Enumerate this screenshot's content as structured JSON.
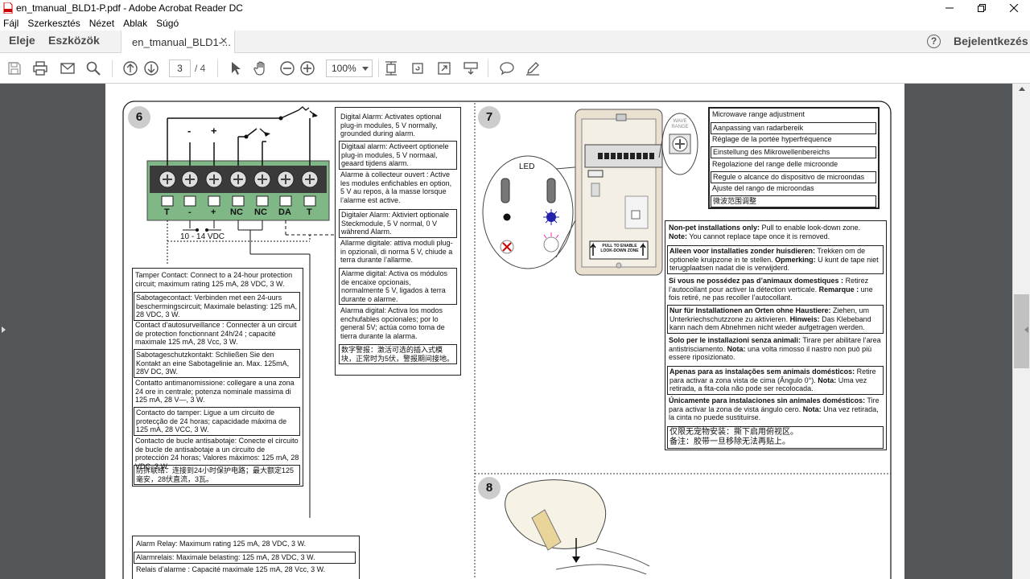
{
  "window": {
    "title": "en_tmanual_BLD1-P.pdf - Adobe Acrobat Reader DC"
  },
  "menu": [
    "Fájl",
    "Szerkesztés",
    "Nézet",
    "Ablak",
    "Súgó"
  ],
  "tabs": {
    "home": "Eleje",
    "tools": "Eszközök",
    "document": "en_tmanual_BLD1-...",
    "help": "?",
    "login": "Bejelentkezés"
  },
  "toolbar": {
    "page_current": "3",
    "page_total": "/ 4",
    "zoom": "100%"
  },
  "doc": {
    "step6": "6",
    "step7": "7",
    "step8": "8",
    "terminals": [
      "T",
      "-",
      "+",
      "NC",
      "NC",
      "DA",
      "T"
    ],
    "top_minus": "-",
    "top_plus": "+",
    "vdc": "10 - 14 VDC",
    "digital_alarm": [
      "Digital Alarm: Activates optional plug-in modules, 5 V normally, grounded during alarm.",
      "Digitaal alarm: Activeert optionele plug-in modules, 5 V normaal, geaard tijdens alarm.",
      "Alarme à collecteur ouvert : Active les modules enfichables en option, 5 V au repos, à la masse lorsque l’alarme est active.",
      "Digitaler Alarm: Aktiviert optionale Steckmodule, 5 V normal, 0 V während Alarm.",
      "Allarme digitale: attiva moduli plug-in opzionali, di norma 5 V, chiude a terra durante l’allarme.",
      "Alarme digital: Activa os módulos de encaixe opcionais, normalmente 5 V, ligados à terra durante o alarme.",
      "Alarma digital: Activa los modos enchufables opcionales; por lo general 5V; actúa como toma de tierra durante la alarma.",
      "数字警报：激活可选的插入式模块，正常时为5伏，警报期间接地。"
    ],
    "tamper": [
      "Tamper Contact: Connect to a 24-hour protection circuit; maximum rating 125 mA, 28 VDC, 3 W.",
      "Sabotagecontact: Verbinden met een 24-uurs beschermingscircuit; Maximale belasting: 125 mA, 28 VDC, 3 W.",
      "Contact d’autosurveillance : Connecter à un circuit de protection fonctionnant 24h/24 ; capacité maximale 125 mA, 28 Vcc, 3 W.",
      "Sabotageschutzkontakt: Schließen Sie den Kontakt an eine Sabotagelinie an.  Max. 125mA, 28V DC, 3W.",
      "Contatto antimanomissione: collegare a una zona 24 ore in centrale; potenza nominale massima di 125 mA, 28 V—, 3 W.",
      "Contacto do tamper: Ligue a um circuito de protecção de 24 horas; capacidade máxima de 125 mA, 28 VCC, 3 W.",
      "Contacto de bucle antisabotaje: Conecte el circuito de bucle de antisabotaje a un circuito de protección 24 horas; Valores máximos: 125 mA, 28 VDC, 3 W.",
      "防拆联络：连接到24小时保护电路；最大额定125毫安，28伏直流，3瓦。"
    ],
    "alarm_relay": [
      "Alarm Relay: Maximum rating 125 mA, 28 VDC, 3 W.",
      "Alarmrelais: Maximale belasting: 125 mA, 28 VDC, 3 W.",
      "Relais d’alarme : Capacité maximale 125 mA, 28 Vcc, 3 W."
    ],
    "led_label": "LED",
    "wave_range": "WAVE RANGE",
    "pull_label": "PULL TO ENABLE LOOK-DOWN ZONE",
    "microwave": [
      "Microwave range adjustment",
      "Aanpassing van radarbereik",
      "Réglage de la portée hyperfréquence",
      "Einstellung des Mikrowellenbereichs",
      "Regolazione del range delle microonde",
      "Regule o alcance do dispositivo de microondas",
      "Ajuste del rango de microondas",
      "微波范围调整"
    ],
    "nonpet": [
      {
        "bold": "Non-pet installations only:",
        "text": " Pull to enable look-down zone.",
        "bold2": "Note:",
        "text2": " You cannot replace tape once it is removed."
      },
      {
        "bold": "Alleen voor installaties zonder huisdieren:",
        "text": " Trekken om de optionele kruipzone in te stellen.",
        "bold2": "Opmerking:",
        "text2": " U kunt de tape niet terugplaatsen nadat die is verwijderd."
      },
      {
        "bold": "Si vous ne possédez pas d’animaux domestiques :",
        "text": " Retirez l’autocollant pour activer la détection verticale.",
        "bold2": "Remarque :",
        "text2": " une fois retiré, ne pas recoller l’autocollant."
      },
      {
        "bold": "Nur für Installationen an Orten ohne Haustiere:",
        "text": " Ziehen, um Unterkriechschutzzone zu aktivieren.",
        "bold2": "Hinweis:",
        "text2": " Das Klebeband kann nach dem Abnehmen nicht wieder aufgetragen werden."
      },
      {
        "bold": "Solo per le installazioni senza animali:",
        "text": " Tirare per abilitare l’area antistrisciamento.",
        "bold2": "Nota:",
        "text2": " una volta rimosso il nastro non può più essere riposizionato."
      },
      {
        "bold": "Apenas para as instalações sem animais domésticos:",
        "text": " Retire para activar a zona vista de cima (Ângulo 0°).",
        "bold2": "Nota:",
        "text2": " Uma vez retirada, a fita-cola não pode ser recolocada."
      },
      {
        "bold": "Únicamente para instalaciones sin animales domésticos:",
        "text": " Tire para activar la zona de vista ángulo cero.",
        "bold2": "Nota:",
        "text2": " Una vez retirada, la cinta no puede sustituirse."
      },
      {
        "bold": "",
        "text": "仅限无宠物安装：撕下启用俯视区。",
        "bold2": "",
        "text2": "备注：胶带一旦移除无法再贴上。"
      }
    ]
  }
}
